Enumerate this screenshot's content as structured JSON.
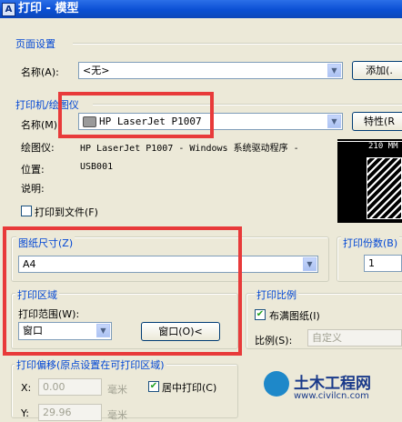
{
  "window": {
    "title": "打印 - 模型",
    "icon": "autocad-app-icon"
  },
  "page_setup": {
    "group_label": "页面设置",
    "name_label": "名称(A):",
    "name_value": "<无>",
    "add_button": "添加(."
  },
  "printer": {
    "group_label": "打印机/绘图仪",
    "name_label": "名称(M):",
    "name_value": "HP LaserJet P1007",
    "properties_button": "特性(R",
    "plotter_label": "绘图仪:",
    "plotter_value": "HP LaserJet P1007 - Windows 系统驱动程序 -",
    "location_label": "位置:",
    "location_value": "USB001",
    "description_label": "说明:",
    "print_to_file_label": "打印到文件(F)",
    "preview_dimension": "210 MM"
  },
  "paper_size": {
    "group_label": "图纸尺寸(Z)",
    "value": "A4"
  },
  "copies": {
    "group_label": "打印份数(B)",
    "value": "1"
  },
  "plot_area": {
    "group_label": "打印区域",
    "what_label": "打印范围(W):",
    "what_value": "窗口",
    "window_button": "窗口(O)<"
  },
  "plot_scale": {
    "group_label": "打印比例",
    "fit_label": "布满图纸(I)",
    "fit_checked": true,
    "scale_label": "比例(S):",
    "scale_value": "自定义"
  },
  "plot_offset": {
    "group_label": "打印偏移(原点设置在可打印区域)",
    "x_label": "X:",
    "x_value": "0.00",
    "x_unit": "毫米",
    "y_label": "Y:",
    "y_value": "29.96",
    "y_unit": "毫米",
    "center_label": "居中打印(C)",
    "center_checked": true
  },
  "watermark": {
    "brand": "土木工程网",
    "url": "www.civilcn.com"
  }
}
